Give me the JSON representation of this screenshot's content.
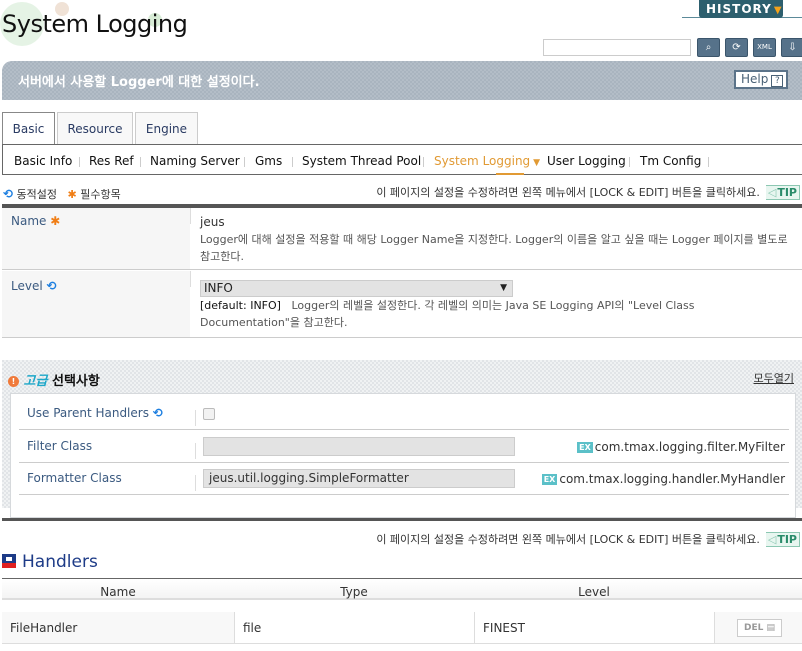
{
  "header": {
    "title": "System Logging",
    "history_label": "HISTORY",
    "search_placeholder": "",
    "toolbar": [
      {
        "name": "search-button",
        "icon": "🔍"
      },
      {
        "name": "refresh-button",
        "icon": "⟳"
      },
      {
        "name": "export-xml-button",
        "icon": "XML"
      },
      {
        "name": "import-button",
        "icon": "⇩"
      }
    ]
  },
  "banner": {
    "description": "서버에서 사용할 Logger에 대한 설정이다.",
    "help_label": "Help",
    "help_icon": "?"
  },
  "tabs": [
    {
      "label": "Basic",
      "active": true
    },
    {
      "label": "Resource",
      "active": false
    },
    {
      "label": "Engine",
      "active": false
    }
  ],
  "subtabs": [
    {
      "label": "Basic Info"
    },
    {
      "label": "Res Ref"
    },
    {
      "label": "Naming Server"
    },
    {
      "label": "Gms"
    },
    {
      "label": "System Thread Pool"
    },
    {
      "label": "System Logging",
      "active": true
    },
    {
      "label": "User Logging"
    },
    {
      "label": "Tm Config"
    }
  ],
  "legend": {
    "dynamic": "동적설정",
    "required": "필수항목",
    "tip_text": "이 페이지의 설정을 수정하려면 왼쪽 메뉴에서 [LOCK & EDIT] 버튼을 클릭하세요.",
    "tip_badge": "TIP"
  },
  "form": {
    "name": {
      "label": "Name",
      "value": "jeus",
      "description": "Logger에 대해 설정을 적용할 때 해당 Logger Name을 지정한다. Logger의 이름을 알고 싶을 때는 Logger 페이지를 별도로 참고한다."
    },
    "level": {
      "label": "Level",
      "selected": "INFO",
      "default": "[default: INFO]",
      "description": "Logger의 레벨을 설정한다. 각 레벨의 의미는 Java SE Logging API의 \"Level Class Documentation\"을 참고한다."
    }
  },
  "advanced": {
    "title_prefix": "고급",
    "title": "선택사항",
    "open_all": "모두열기",
    "use_parent_handlers": {
      "label": "Use Parent Handlers",
      "checked": false
    },
    "filter_class": {
      "label": "Filter Class",
      "value": "",
      "example_badge": "EX",
      "example": "com.tmax.logging.filter.MyFilter"
    },
    "formatter_class": {
      "label": "Formatter Class",
      "value": "jeus.util.logging.SimpleFormatter",
      "example_badge": "EX",
      "example": "com.tmax.logging.handler.MyHandler"
    }
  },
  "handlers": {
    "tip_text": "이 페이지의 설정을 수정하려면 왼쪽 메뉴에서 [LOCK & EDIT] 버튼을 클릭하세요.",
    "tip_badge": "TIP",
    "title": "Handlers",
    "columns": [
      "Name",
      "Type",
      "Level"
    ],
    "rows": [
      {
        "name": "FileHandler",
        "type": "file",
        "level": "FINEST",
        "action": "DEL"
      }
    ]
  }
}
